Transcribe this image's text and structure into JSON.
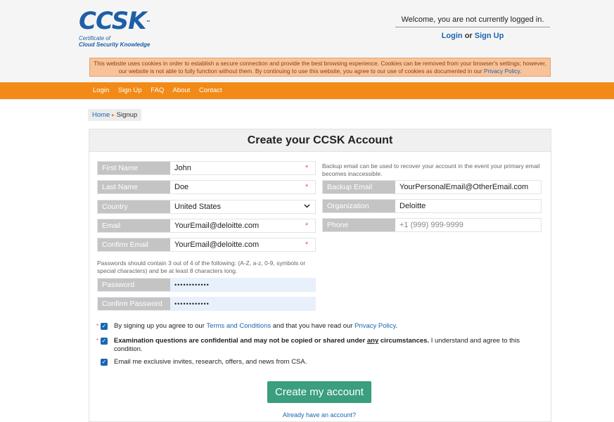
{
  "brand": {
    "logo_text": "CCSK",
    "logo_tm": "™",
    "subtitle_line1": "Certificate of",
    "subtitle_line2": "Cloud Security Knowledge"
  },
  "header": {
    "welcome": "Welcome, you are not currently logged in.",
    "login_label": "Login",
    "or_label": "or",
    "signup_label": "Sign Up"
  },
  "cookie_notice": {
    "text": "This website uses cookies in order to establish a secure connection and provide the best browsing experience. Cookies can be removed from your browser's settings; however, our website is not able to fully function without them. By continuing to use this website, you agree to our use of cookies as documented in our",
    "link": "Privacy Policy",
    "end": "."
  },
  "nav": {
    "items": [
      "Login",
      "Sign Up",
      "FAQ",
      "About",
      "Contact"
    ]
  },
  "breadcrumb": {
    "home": "Home",
    "separator": "▸",
    "current": "Signup"
  },
  "form": {
    "title": "Create your CCSK Account",
    "first_name": {
      "label": "First Name",
      "value": "John"
    },
    "last_name": {
      "label": "Last Name",
      "value": "Doe"
    },
    "country": {
      "label": "Country",
      "value": "United States"
    },
    "email": {
      "label": "Email",
      "value": "YourEmail@deloitte.com"
    },
    "confirm_email": {
      "label": "Confirm Email",
      "value": "YourEmail@deloitte.com"
    },
    "password_note": "Passwords should contain 3 out of 4 of the following: (A-Z, a-z, 0-9, symbols or special characters) and be at least 8 characters long.",
    "password": {
      "label": "Password",
      "value": "••••••••••••"
    },
    "confirm_password": {
      "label": "Confirm Password",
      "value": "••••••••••••"
    },
    "backup_note": "Backup email can be used to recover your account in the event your primary email becomes inaccessible.",
    "backup_email": {
      "label": "Backup Email",
      "value": "YourPersonalEmail@OtherEmail.com"
    },
    "organization": {
      "label": "Organization",
      "value": "Deloitte"
    },
    "phone": {
      "label": "Phone",
      "placeholder": "+1 (999) 999-9999"
    },
    "required_mark": "*",
    "dropdown_icon": "chevron-down-icon"
  },
  "agreements": {
    "terms_prefix": "By signing up you agree to our",
    "terms_link": "Terms and Conditions",
    "terms_middle": "and that you have read our",
    "privacy_link": "Privacy Policy",
    "terms_end": ".",
    "exam_bold_1": "Examination questions are confidential and may not be copied or shared under",
    "exam_bold_any": "any",
    "exam_bold_2": "circumstances.",
    "exam_rest": "I understand and agree to this condition.",
    "marketing": "Email me exclusive invites, research, offers, and news from CSA."
  },
  "actions": {
    "create_button": "Create my account",
    "already_link": "Already have an account?"
  },
  "colors": {
    "brand_blue": "#1d5fa8",
    "nav_orange": "#f28a17",
    "button_green": "#3a9e7f",
    "cookie_bg": "#f9c39a"
  }
}
